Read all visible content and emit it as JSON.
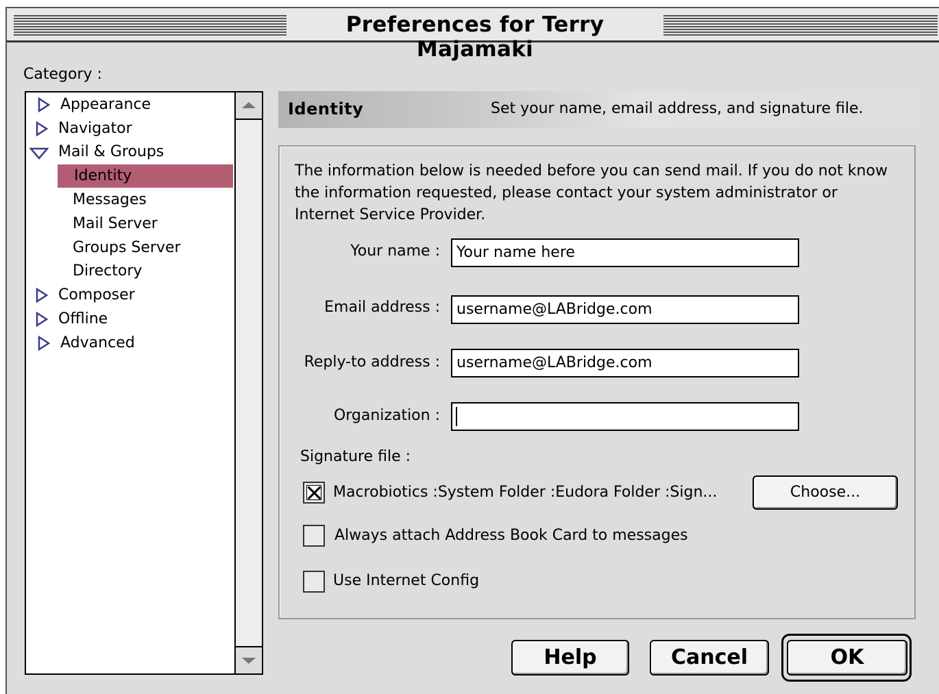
{
  "window": {
    "title": "Preferences for Terry Majamaki"
  },
  "category_label": "Category :",
  "tree": {
    "items": [
      {
        "label": "Appearance",
        "expanded": false
      },
      {
        "label": "Navigator",
        "expanded": false
      },
      {
        "label": "Mail & Groups",
        "expanded": true
      },
      {
        "label": "Identity",
        "selected": true
      },
      {
        "label": "Messages"
      },
      {
        "label": "Mail Server"
      },
      {
        "label": "Groups Server"
      },
      {
        "label": "Directory"
      },
      {
        "label": "Composer",
        "expanded": false
      },
      {
        "label": "Offline",
        "expanded": false
      },
      {
        "label": "Advanced",
        "expanded": false
      }
    ]
  },
  "header": {
    "section": "Identity",
    "description": "Set your name, email address, and signature file."
  },
  "intro": "The information below is needed before you can send mail. If you do not know the information requested, please contact your system administrator or Internet Service Provider.",
  "fields": {
    "name": {
      "label": "Your name :",
      "value": "Your name here"
    },
    "email": {
      "label": "Email address :",
      "value": "username@LABridge.com"
    },
    "reply_to": {
      "label": "Reply-to address :",
      "value": "username@LABridge.com"
    },
    "organization": {
      "label": "Organization :",
      "value": ""
    }
  },
  "signature": {
    "label": "Signature file :",
    "path": "Macrobiotics :System Folder :Eudora Folder :Sign...",
    "checked": true,
    "choose_label": "Choose..."
  },
  "options": {
    "attach_card": {
      "label": "Always attach Address Book Card to messages",
      "checked": false
    },
    "internet_config": {
      "label": "Use Internet Config",
      "checked": false
    }
  },
  "buttons": {
    "help": "Help",
    "cancel": "Cancel",
    "ok": "OK"
  },
  "colors": {
    "selection": "#b35d73",
    "window_bg": "#dddddd"
  }
}
